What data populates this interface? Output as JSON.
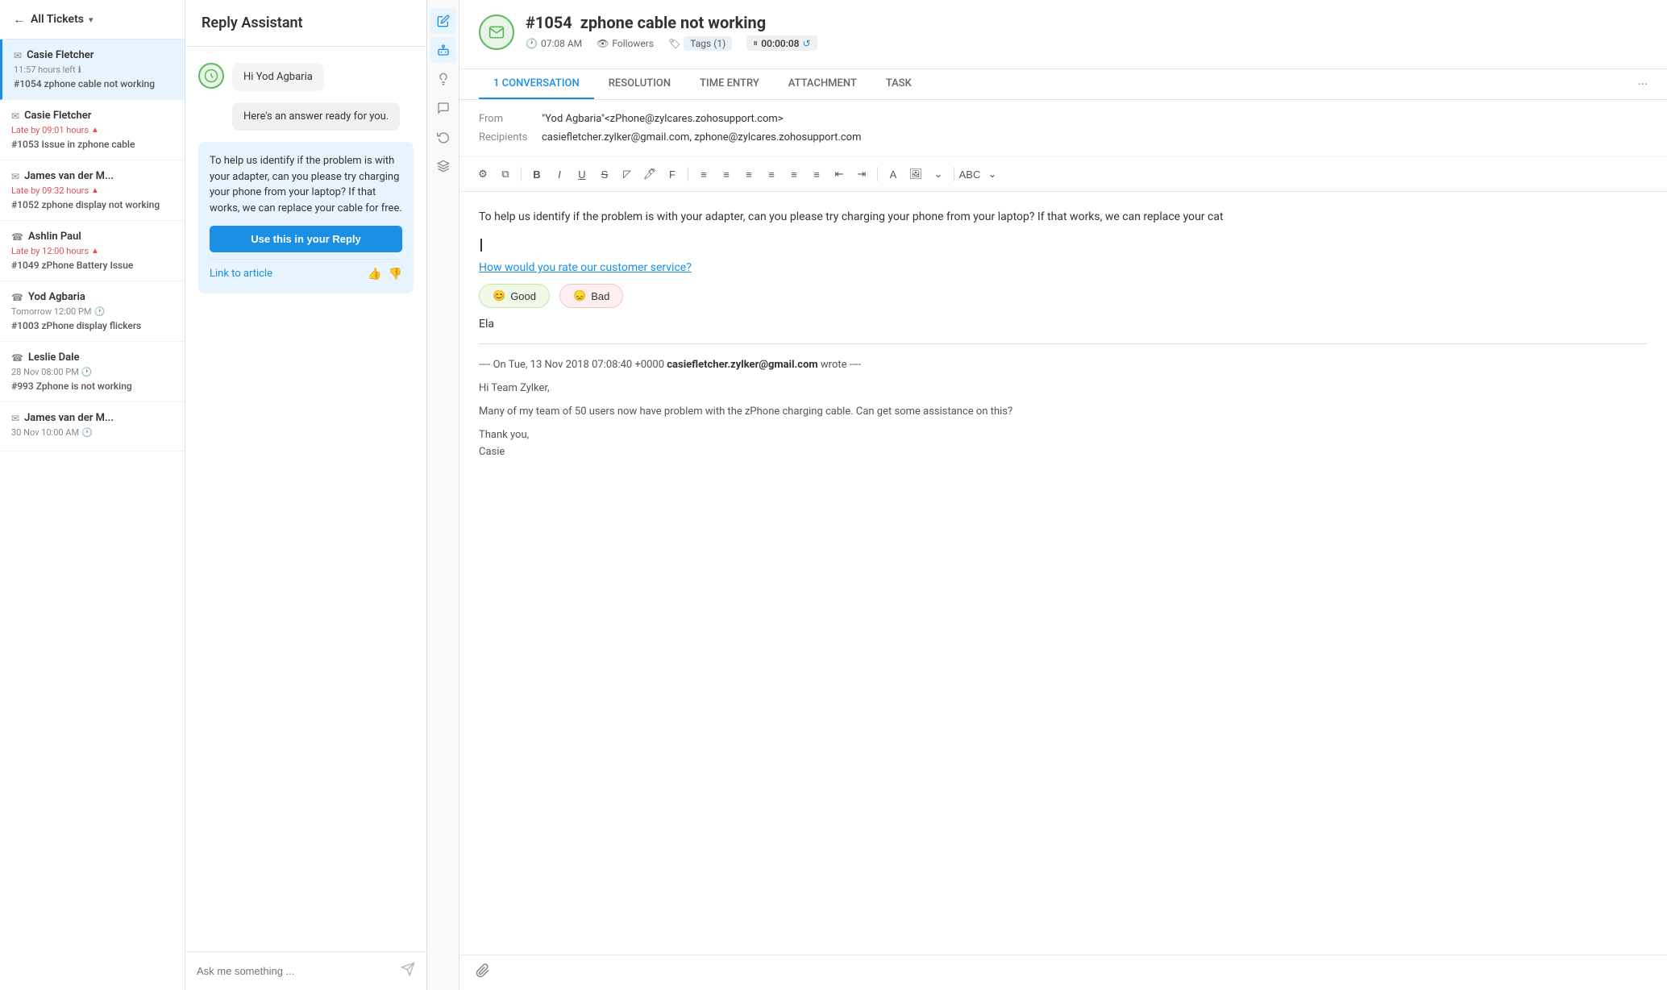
{
  "sidebar": {
    "back_label": "All Tickets",
    "items": [
      {
        "contact": "Casie Fletcher",
        "time": "11:57 hours left",
        "time_type": "normal",
        "ticket_id": "#1054",
        "subject": "zphone cable not working",
        "icon": "✉",
        "active": true,
        "info_icon": "ℹ"
      },
      {
        "contact": "Casie Fletcher",
        "time": "Late by 09:01 hours",
        "time_type": "late",
        "ticket_id": "#1053",
        "subject": "Issue in zphone cable",
        "icon": "✉",
        "active": false,
        "late_indicator": "▲"
      },
      {
        "contact": "James van der M...",
        "time": "Late by 09:32 hours",
        "time_type": "late",
        "ticket_id": "#1052",
        "subject": "zphone display not working",
        "icon": "✉",
        "active": false,
        "late_indicator": "▲"
      },
      {
        "contact": "Ashlin Paul",
        "time": "Late by 12:00 hours",
        "time_type": "late",
        "ticket_id": "#1049",
        "subject": "zPhone Battery Issue",
        "icon": "☎",
        "active": false,
        "late_indicator": "▲"
      },
      {
        "contact": "Yod Agbaria",
        "time": "Tomorrow 12:00 PM",
        "time_type": "normal",
        "ticket_id": "#1003",
        "subject": "zPhone display flickers",
        "icon": "☎",
        "active": false,
        "clock_icon": "🕐"
      },
      {
        "contact": "Leslie Dale",
        "time": "28 Nov 08:00 PM",
        "time_type": "normal",
        "ticket_id": "#993",
        "subject": "Zphone is not working",
        "icon": "☎",
        "active": false,
        "clock_icon": "🕐"
      },
      {
        "contact": "James van der M...",
        "time": "30 Nov 10:00 AM",
        "time_type": "normal",
        "ticket_id": "",
        "subject": "",
        "icon": "✉",
        "active": false,
        "clock_icon": "🕐"
      }
    ]
  },
  "reply_assistant": {
    "title": "Reply Assistant",
    "bot_message": "Hi Yod Agbaria",
    "ready_message": "Here's an answer ready for you.",
    "response_text": "To help us identify if the problem is with your adapter, can you please try charging your phone from your laptop? If that works, we can replace your cable for free.",
    "use_reply_button": "Use this in your Reply",
    "link_article": "Link to article",
    "input_placeholder": "Ask me something ...",
    "thumbs_up": "👍",
    "thumbs_down": "👎"
  },
  "side_icons": [
    {
      "name": "edit-icon",
      "symbol": "✏",
      "active": true
    },
    {
      "name": "robot-icon",
      "symbol": "🤖",
      "active": true
    },
    {
      "name": "lightbulb-icon",
      "symbol": "💡",
      "active": false
    },
    {
      "name": "chat-icon",
      "symbol": "💬",
      "active": false
    },
    {
      "name": "history-icon",
      "symbol": "↺",
      "active": false
    },
    {
      "name": "layers-icon",
      "symbol": "⊞",
      "active": false
    }
  ],
  "ticket_detail": {
    "ticket_id": "#1054",
    "title": "zphone cable not working",
    "avatar_emoji": "✉",
    "time": "07:08 AM",
    "followers_label": "Followers",
    "tags_label": "Tags (1)",
    "timer": "00:00:08",
    "tabs": [
      {
        "label": "1 CONVERSATION",
        "count": "1",
        "active": true
      },
      {
        "label": "RESOLUTION",
        "active": false
      },
      {
        "label": "TIME ENTRY",
        "active": false
      },
      {
        "label": "ATTACHMENT",
        "active": false
      },
      {
        "label": "TASK",
        "active": false
      }
    ],
    "from_label": "From",
    "from_value": "\"Yod Agbaria\"<zPhone@zylcares.zohosupport.com>",
    "recipients_label": "Recipients",
    "recipients_value": "casiefletcher.zylker@gmail.com, zphone@zylcares.zohosupport.com",
    "compose_text": "To help us identify if the problem is with your adapter, can you please try charging your phone from your laptop? If that works, we can replace your cat",
    "satisfaction_link": "How would you rate our customer service?",
    "satisfaction_good": "Good",
    "satisfaction_bad": "Bad",
    "signature": "Ela",
    "quoted_header": "---- On Tue, 13 Nov 2018 07:08:40 +0000",
    "quoted_sender_bold": "casiefletcher.zylker@gmail.com",
    "quoted_wrote": "wrote ----",
    "quoted_greeting": "Hi Team Zylker,",
    "quoted_body": "Many of my team of 50 users now have problem with the zPhone charging cable. Can get some assistance on this?",
    "quoted_sign": "Thank you,\nCasie",
    "toolbar_buttons": [
      "⚙",
      "⧉",
      "B",
      "I",
      "U",
      "—",
      "◸",
      "🖊",
      "F",
      "≡",
      "≡",
      "≡",
      "≡",
      "≡",
      "≡",
      "≡",
      "≡",
      "A",
      "🖼",
      "⌄",
      "ABC",
      "⌄"
    ]
  },
  "colors": {
    "accent_blue": "#1a8fe3",
    "active_tab_border": "#1a8fe3",
    "late_red": "#e05252",
    "good_green": "#5cb85c",
    "sidebar_active_bg": "#e8f4fd"
  }
}
